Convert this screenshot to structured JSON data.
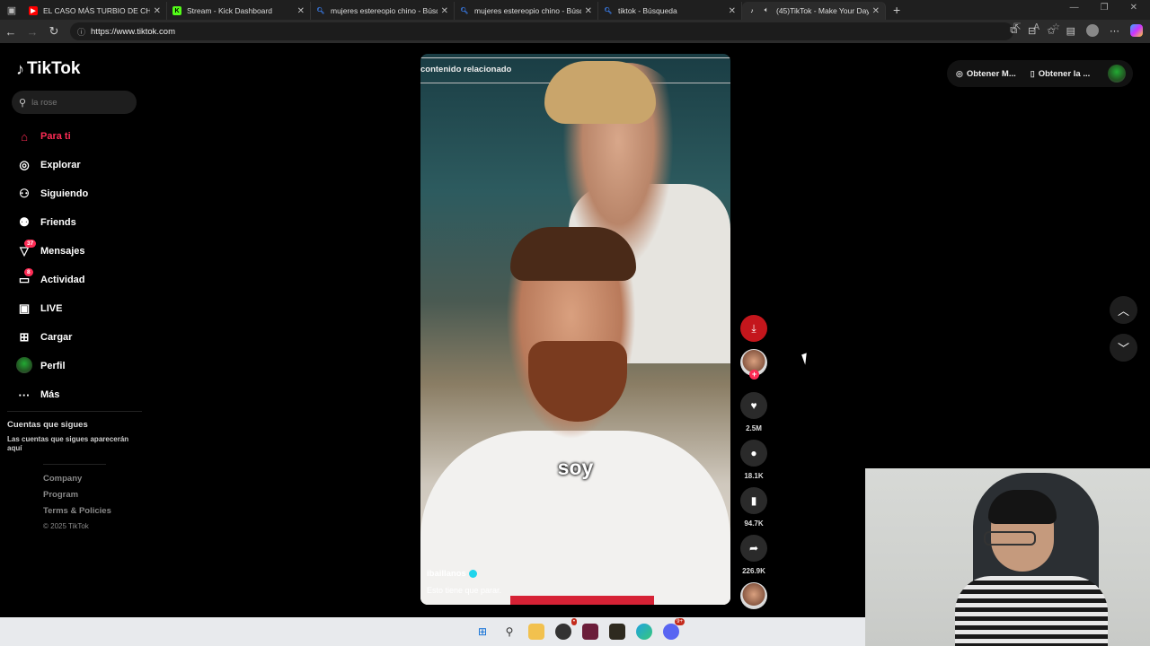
{
  "browser": {
    "tabs": [
      {
        "label": "EL CASO MÁS TURBIO DE CHINA",
        "favicon": "youtube-icon",
        "color": "#ff0000",
        "active": false
      },
      {
        "label": "Stream - Kick Dashboard",
        "favicon": "kick-icon",
        "color": "#53fc18",
        "active": false
      },
      {
        "label": "mujeres estereopio chino - Búsqu",
        "favicon": "search-icon",
        "color": "#3b82f6",
        "active": false
      },
      {
        "label": "mujeres estereopio chino - Búsq",
        "favicon": "search-icon",
        "color": "#3b82f6",
        "active": false
      },
      {
        "label": "tiktok - Búsqueda",
        "favicon": "search-icon",
        "color": "#3b82f6",
        "active": false
      },
      {
        "label": "(45)TikTok - Make Your Day",
        "favicon": "tiktok-icon",
        "color": "#ffffff",
        "active": true
      }
    ],
    "url": "https://www.tiktok.com"
  },
  "sidebar": {
    "logo": "TikTok",
    "search_placeholder": "la rose",
    "items": [
      {
        "label": "Para ti",
        "icon": "home-icon"
      },
      {
        "label": "Explorar",
        "icon": "compass-icon"
      },
      {
        "label": "Siguiendo",
        "icon": "following-icon"
      },
      {
        "label": "Friends",
        "icon": "friends-icon"
      },
      {
        "label": "Mensajes",
        "icon": "messages-icon",
        "badge": "37"
      },
      {
        "label": "Actividad",
        "icon": "activity-icon",
        "badge": "8"
      },
      {
        "label": "LIVE",
        "icon": "live-icon"
      },
      {
        "label": "Cargar",
        "icon": "upload-icon"
      },
      {
        "label": "Perfil",
        "icon": "profile-avatar"
      },
      {
        "label": "Más",
        "icon": "more-icon"
      }
    ],
    "following_title": "Cuentas que sigues",
    "following_sub": "Las cuentas que sigues aparecerán aquí",
    "footer": {
      "company": "Company",
      "program": "Program",
      "terms": "Terms & Policies",
      "copyright": "© 2025 TikTok"
    }
  },
  "video": {
    "related_label": "contenido relacionado",
    "caption_overlay": "soy",
    "author": "ibaillanos",
    "description": "Esto tiene que parar."
  },
  "actions": {
    "likes": "2.5M",
    "comments": "18.1K",
    "saves": "94.7K",
    "shares": "226.9K"
  },
  "topbar": {
    "get_coins": "Obtener M...",
    "get_app": "Obtener la ..."
  },
  "colors": {
    "accent": "#fe2c55",
    "background": "#000000"
  }
}
